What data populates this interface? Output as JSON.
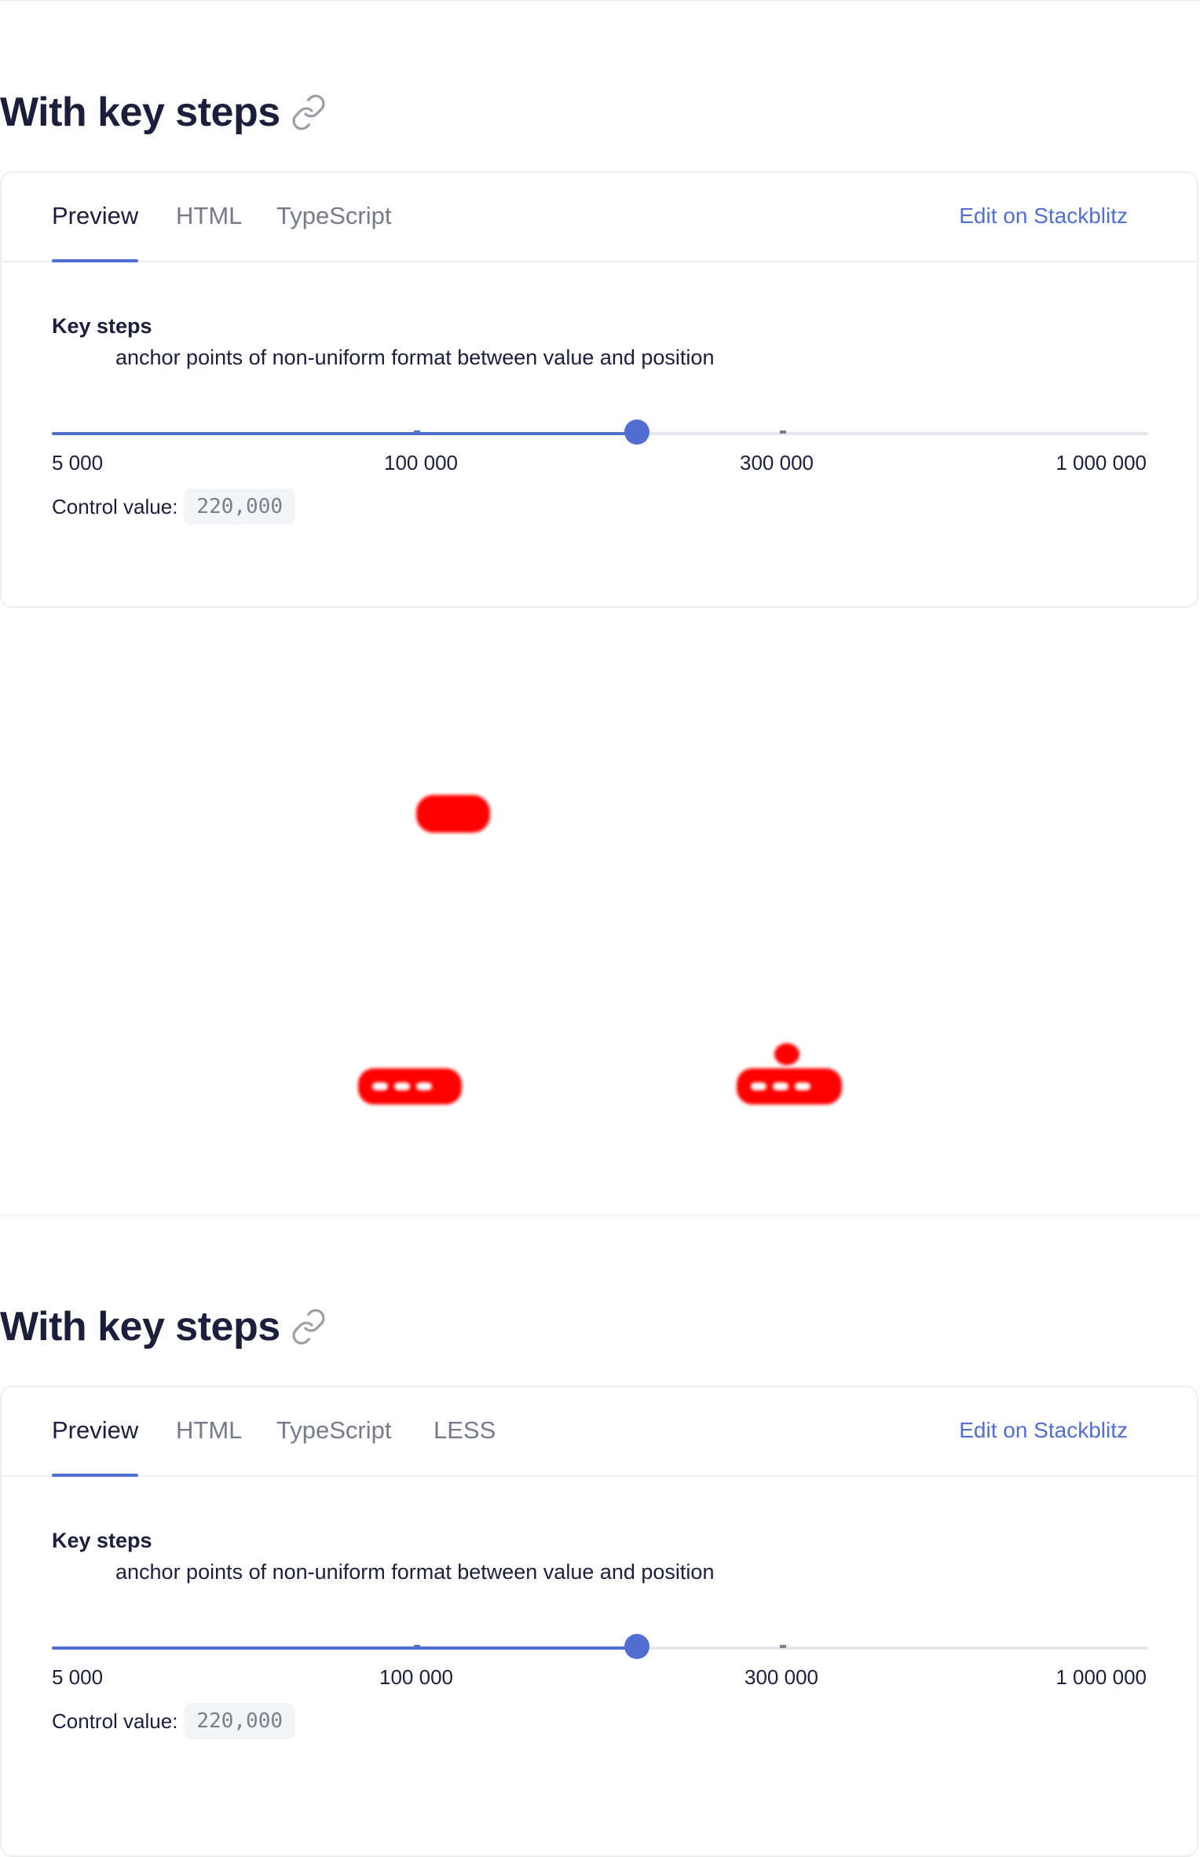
{
  "sections": [
    {
      "title": "With key steps",
      "tabs": [
        "Preview",
        "HTML",
        "TypeScript"
      ],
      "edit_link": "Edit on Stackblitz",
      "demo": {
        "label": "Key steps",
        "description": "anchor points of non-uniform format between value and position",
        "tick_labels": [
          "5 000",
          "100 000",
          "300 000",
          "1 000 000"
        ],
        "control_label": "Control value:",
        "control_value": "220,000"
      }
    },
    {
      "title": "With key steps",
      "tabs": [
        "Preview",
        "HTML",
        "TypeScript",
        "LESS"
      ],
      "edit_link": "Edit on Stackblitz",
      "demo": {
        "label": "Key steps",
        "description": "anchor points of non-uniform format between value and position",
        "tick_labels": [
          "5 000",
          "100 000",
          "300 000",
          "1 000 000"
        ],
        "control_label": "Control value:",
        "control_value": "220,000"
      }
    }
  ],
  "slider": {
    "min": 5000,
    "max": 1000000,
    "value": 220000,
    "key_steps": [
      [
        0,
        5000
      ],
      [
        33.33,
        100000
      ],
      [
        66.67,
        300000
      ],
      [
        100,
        1000000
      ]
    ]
  },
  "colors": {
    "accent": "#526ed3",
    "heading": "#1b1f3b",
    "muted": "#767a8a",
    "border": "#eceef3",
    "redaction": "#ff0000"
  },
  "icons": {
    "anchor_link": "link-icon"
  }
}
